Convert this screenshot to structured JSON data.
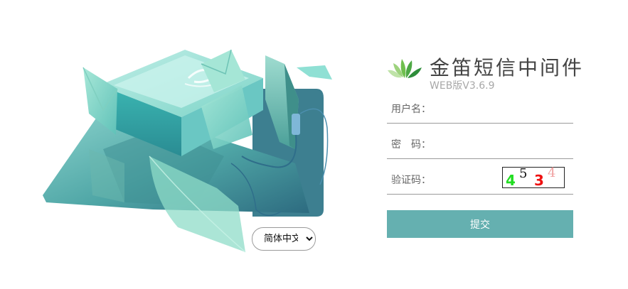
{
  "app": {
    "title": "金笛短信中间件",
    "version": "WEB版V3.6.9"
  },
  "form": {
    "username_label": "用户名：",
    "password_label": "密　码：",
    "captcha_label": "验证码：",
    "submit_label": "提交"
  },
  "captcha": {
    "chars": [
      "4",
      "5",
      "3",
      "4"
    ],
    "colors": [
      "#22dd22",
      "#111111",
      "#ee1111",
      "#f0a0a0"
    ]
  },
  "language": {
    "selected": "简体中文",
    "options": [
      "简体中文"
    ]
  },
  "colors": {
    "accent": "#65b0b0",
    "title": "#444444",
    "version": "#a8a8a8"
  }
}
